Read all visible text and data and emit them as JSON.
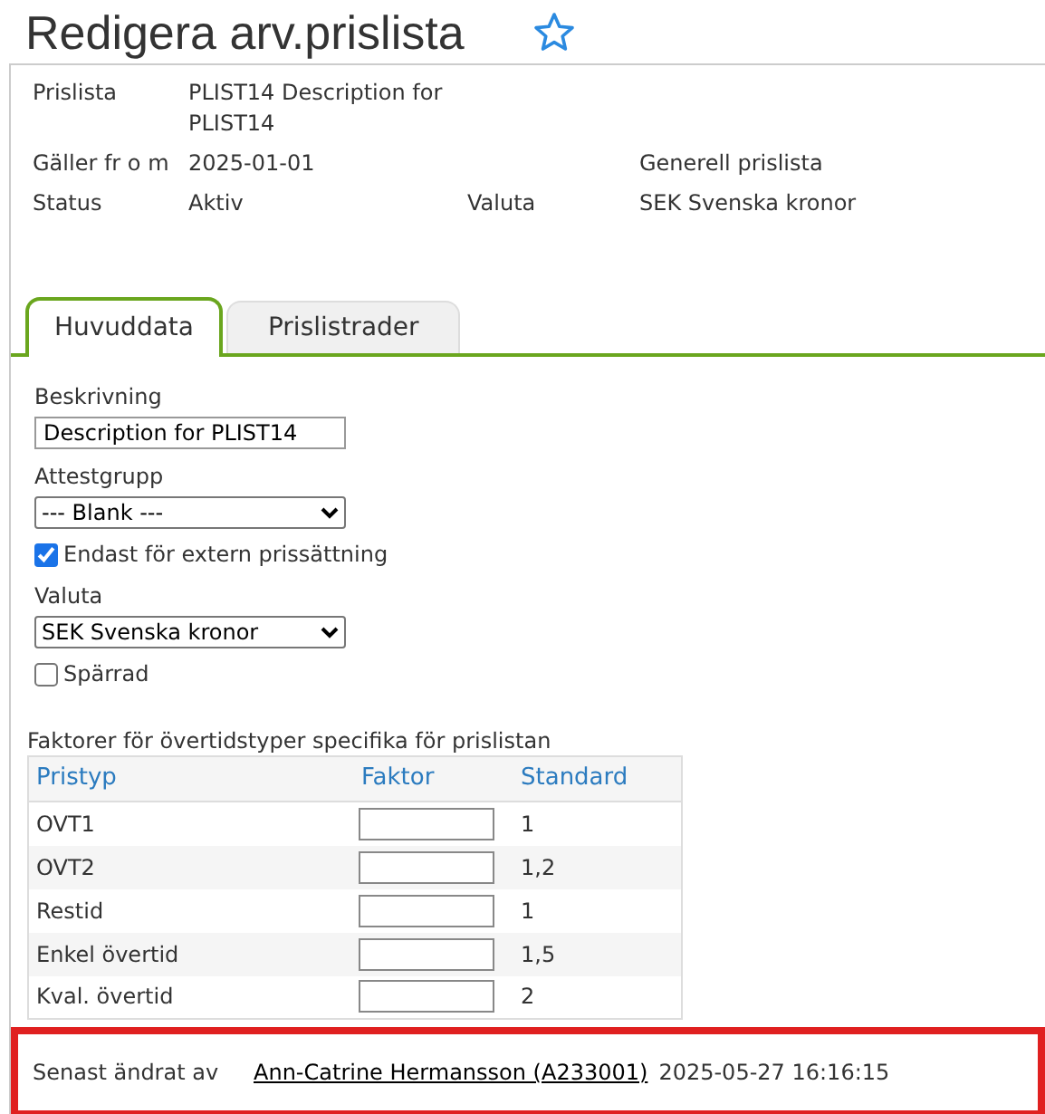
{
  "page_title": "Redigera arv.prislista",
  "favorite": {
    "starred": false
  },
  "info": [
    {
      "label": "Prislista",
      "value": "PLIST14 Description for PLIST14"
    },
    {
      "label": "Gäller fr o m",
      "value": "2025-01-01",
      "extra_value": "Generell prislista"
    },
    {
      "label": "Status",
      "value": "Aktiv",
      "extra_label": "Valuta",
      "extra_value": "SEK Svenska kronor"
    }
  ],
  "tabs": [
    {
      "label": "Huvuddata",
      "selected": true
    },
    {
      "label": "Prislistrader",
      "selected": false
    }
  ],
  "form": [
    {
      "kind": "text",
      "label": "Beskrivning",
      "value": "Description for PLIST14"
    },
    {
      "kind": "select",
      "label": "Attestgrupp",
      "value": "--- Blank ---"
    },
    {
      "kind": "checkbox",
      "label": "Endast för extern prissättning",
      "checked": true
    },
    {
      "kind": "select",
      "label": "Valuta",
      "value": "SEK Svenska kronor"
    },
    {
      "kind": "checkbox",
      "label": "Spärrad",
      "checked": false
    }
  ],
  "factors": {
    "caption": "Faktorer för övertidstyper specifika för prislistan",
    "columns": [
      "Pristyp",
      "Faktor",
      "Standard"
    ],
    "rows": [
      {
        "type": "OVT1",
        "standard": "1"
      },
      {
        "type": "OVT2",
        "standard": "1,2"
      },
      {
        "type": "Restid",
        "standard": "1"
      },
      {
        "type": "Enkel övertid",
        "standard": "1,5"
      },
      {
        "type": "Kval. övertid",
        "standard": "2"
      }
    ]
  },
  "last_changed": {
    "label": "Senast ändrat av",
    "user": "Ann-Catrine Hermansson (A233001)",
    "timestamp": "2025-05-27 16:16:15"
  }
}
